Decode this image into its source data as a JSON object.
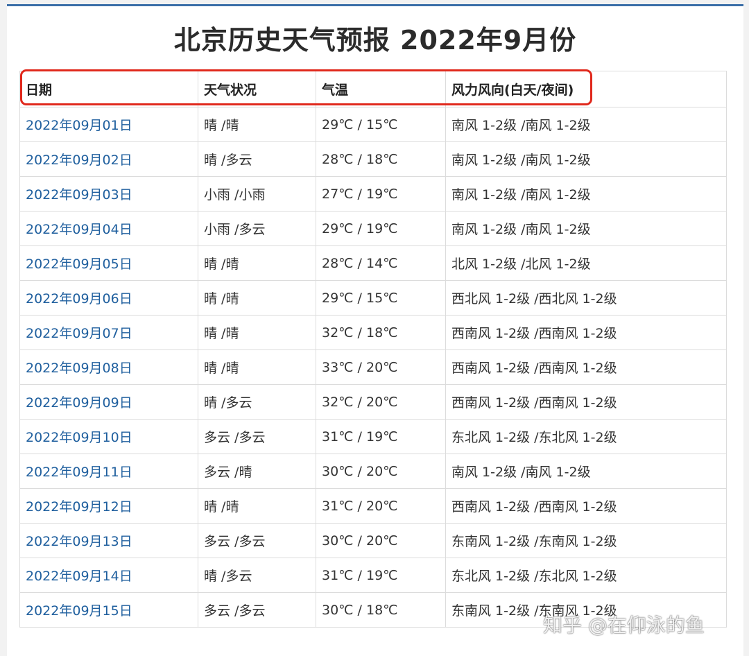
{
  "title": "北京历史天气预报 2022年9月份",
  "table": {
    "headers": [
      "日期",
      "天气状况",
      "气温",
      "风力风向(白天/夜间)"
    ],
    "rows": [
      [
        "2022年09月01日",
        "晴 /晴",
        "29℃ / 15℃",
        "南风 1-2级 /南风 1-2级"
      ],
      [
        "2022年09月02日",
        "晴 /多云",
        "28℃ / 18℃",
        "南风 1-2级 /南风 1-2级"
      ],
      [
        "2022年09月03日",
        "小雨 /小雨",
        "27℃ / 19℃",
        "南风 1-2级 /南风 1-2级"
      ],
      [
        "2022年09月04日",
        "小雨 /多云",
        "29℃ / 19℃",
        "南风 1-2级 /南风 1-2级"
      ],
      [
        "2022年09月05日",
        "晴 /晴",
        "28℃ / 14℃",
        "北风 1-2级 /北风 1-2级"
      ],
      [
        "2022年09月06日",
        "晴 /晴",
        "29℃ / 15℃",
        "西北风 1-2级 /西北风 1-2级"
      ],
      [
        "2022年09月07日",
        "晴 /晴",
        "32℃ / 18℃",
        "西南风 1-2级 /西南风 1-2级"
      ],
      [
        "2022年09月08日",
        "晴 /晴",
        "33℃ / 20℃",
        "西南风 1-2级 /西南风 1-2级"
      ],
      [
        "2022年09月09日",
        "晴 /多云",
        "32℃ / 20℃",
        "西南风 1-2级 /西南风 1-2级"
      ],
      [
        "2022年09月10日",
        "多云 /多云",
        "31℃ / 19℃",
        "东北风 1-2级 /东北风 1-2级"
      ],
      [
        "2022年09月11日",
        "多云 /晴",
        "30℃ / 20℃",
        "南风 1-2级 /南风 1-2级"
      ],
      [
        "2022年09月12日",
        "晴 /晴",
        "31℃ / 20℃",
        "西南风 1-2级 /西南风 1-2级"
      ],
      [
        "2022年09月13日",
        "多云 /多云",
        "30℃ / 20℃",
        "东南风 1-2级 /东南风 1-2级"
      ],
      [
        "2022年09月14日",
        "晴 /多云",
        "31℃ / 19℃",
        "东北风 1-2级 /东北风 1-2级"
      ],
      [
        "2022年09月15日",
        "多云 /多云",
        "30℃ / 18℃",
        "东南风 1-2级 /东南风 1-2级"
      ]
    ]
  },
  "watermark": "知乎 @在仰泳的鱼",
  "colors": {
    "link": "#1f5f9e",
    "highlight_outline": "#e0281c",
    "top_border": "#3a6ea8"
  }
}
